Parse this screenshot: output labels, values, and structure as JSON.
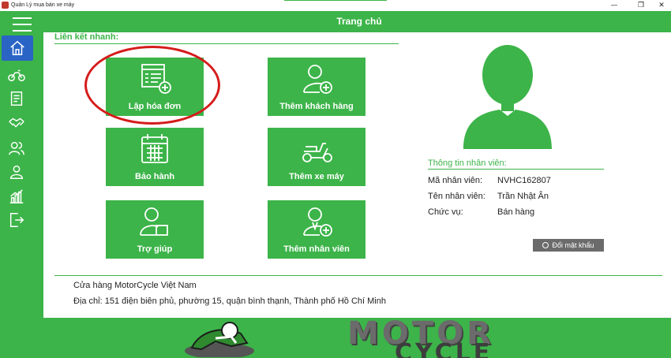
{
  "window": {
    "title": "Quản Lý mua bán xe máy",
    "controls": {
      "minimize": "—",
      "maximize": "❐",
      "close": "✕"
    }
  },
  "header": {
    "title": "Trang chủ"
  },
  "sidebar": {
    "items": [
      {
        "icon": "home-icon",
        "active": true
      },
      {
        "icon": "motorcycle-icon"
      },
      {
        "icon": "invoice-icon"
      },
      {
        "icon": "handshake-icon"
      },
      {
        "icon": "customers-icon"
      },
      {
        "icon": "employee-icon"
      },
      {
        "icon": "chart-icon"
      },
      {
        "icon": "logout-icon"
      }
    ]
  },
  "quicklinks": {
    "label": "Liên kết nhanh:",
    "tiles": [
      {
        "label": "Lập hóa đơn",
        "icon": "invoice-add-icon"
      },
      {
        "label": "Thêm khách hàng",
        "icon": "add-customer-icon"
      },
      {
        "label": "Bảo hành",
        "icon": "calendar-icon"
      },
      {
        "label": "Thêm xe máy",
        "icon": "scooter-icon"
      },
      {
        "label": "Trợ giúp",
        "icon": "help-person-icon"
      },
      {
        "label": "Thêm nhân viên",
        "icon": "add-employee-icon"
      }
    ]
  },
  "employee": {
    "section_title": "Thông tin nhân viên:",
    "id_label": "Mã nhân viên:",
    "id_value": "NVHC162807",
    "name_label": "Tên nhân viên:",
    "name_value": "Trần Nhật Ân",
    "role_label": "Chức vụ:",
    "role_value": "Bán hàng",
    "change_password": "Đổi mật khẩu"
  },
  "store": {
    "name": "Cửa hàng MotorCycle Việt Nam",
    "address": "Địa chỉ: 151 điện biên phủ, phường 15, quận bình thạnh, Thành phố Hồ Chí Minh"
  },
  "banner": {
    "word1": "MOTOR",
    "word2": "CYCLE"
  },
  "colors": {
    "accent": "#3cb449",
    "active": "#2a64c5",
    "highlight": "#d61b1b"
  }
}
